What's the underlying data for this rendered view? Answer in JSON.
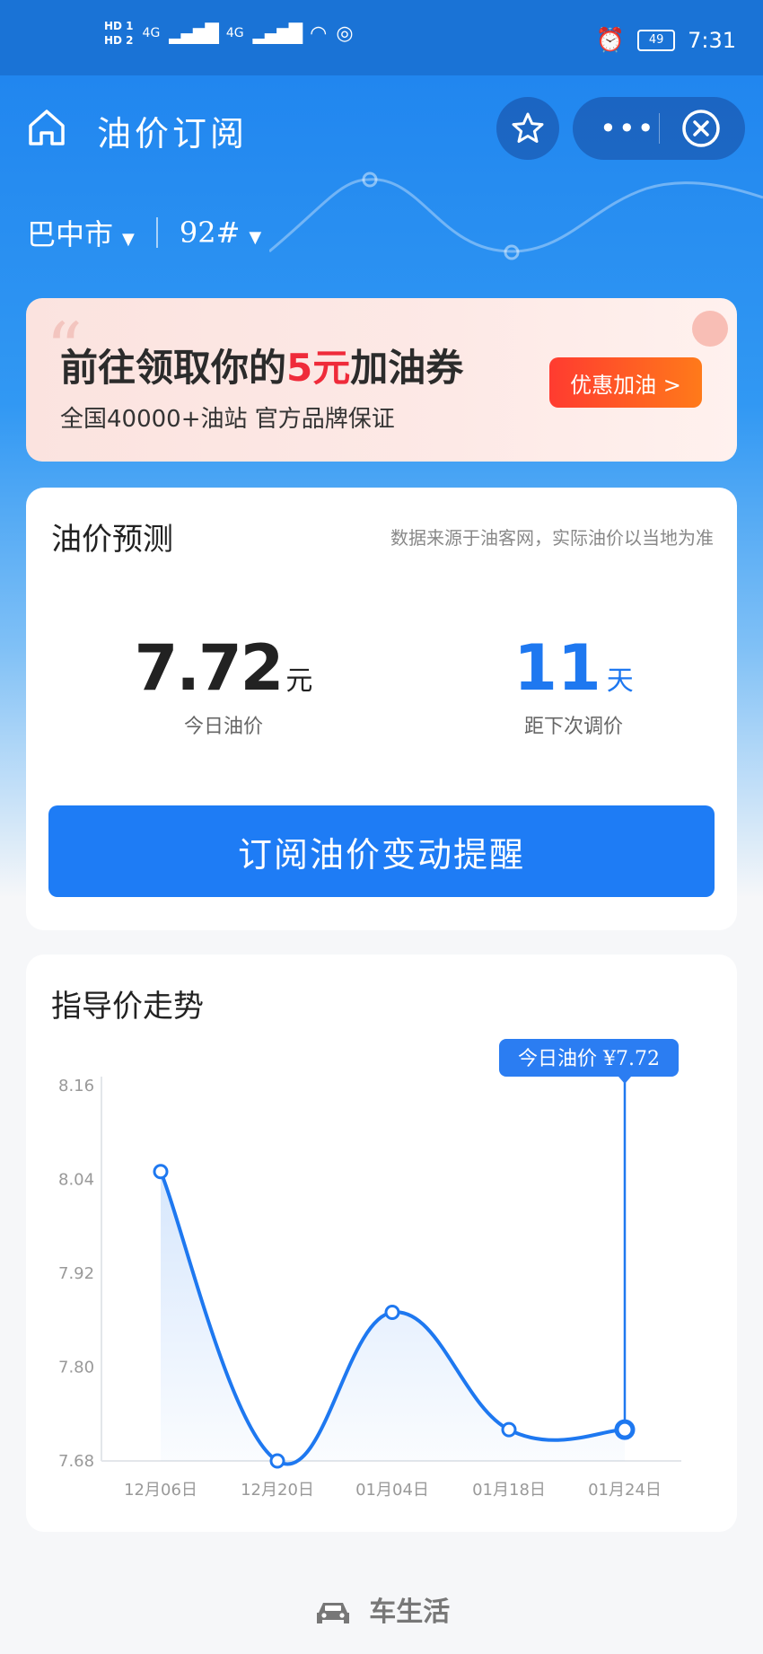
{
  "status_bar": {
    "hd1": "HD 1",
    "hd2": "HD 2",
    "net1": "4G",
    "net2": "4G",
    "battery": "49",
    "time": "7:31"
  },
  "header": {
    "title": "油价订阅"
  },
  "selectors": {
    "city": "巴中市",
    "fuel": "92#"
  },
  "banner": {
    "title_pre": "前往领取你的",
    "title_highlight": "5元",
    "title_post": "加油券",
    "subtitle": "全国40000+油站 官方品牌保证",
    "cta": "优惠加油 >"
  },
  "forecast": {
    "title": "油价预测",
    "source_note": "数据来源于油客网，实际油价以当地为准",
    "price_value": "7.72",
    "price_unit": "元",
    "price_label": "今日油价",
    "days_value": "11",
    "days_unit": "天",
    "days_label": "距下次调价",
    "subscribe_button": "订阅油价变动提醒"
  },
  "trend": {
    "title": "指导价走势",
    "tooltip": "今日油价 ¥7.72"
  },
  "chart_data": {
    "type": "line",
    "categories": [
      "12月06日",
      "12月20日",
      "01月04日",
      "01月18日",
      "01月24日"
    ],
    "values": [
      8.05,
      7.68,
      7.87,
      7.72,
      7.72
    ],
    "yticks": [
      "8.16",
      "8.04",
      "7.92",
      "7.80",
      "7.68"
    ],
    "ylim": [
      7.68,
      8.16
    ],
    "title": "指导价走势",
    "xlabel": "",
    "ylabel": "",
    "grid": false,
    "accent_color": "#1e78f0"
  },
  "footer": {
    "brand": "车生活"
  },
  "colors": {
    "primary": "#1e7cf5",
    "highlight_red": "#ef2b3a"
  }
}
